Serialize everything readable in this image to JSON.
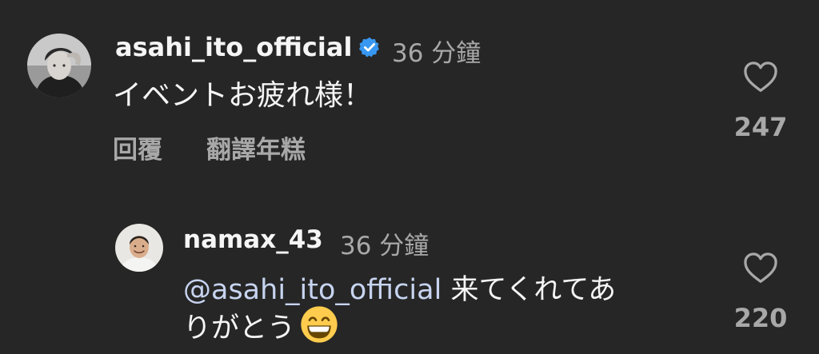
{
  "comments": [
    {
      "username": "asahi_ito_official",
      "verified": true,
      "time": "36 分鐘",
      "text": "イベントお疲れ様！",
      "actions": {
        "reply": "回覆",
        "translate": "翻譯年糕"
      },
      "likes": "247",
      "icons": {
        "avatar": "profile-photo",
        "badge": "verified-badge-icon",
        "like": "heart-outline-icon"
      }
    },
    {
      "username": "namax_43",
      "time": "36 分鐘",
      "mention": "@asahi_ito_official",
      "text_line1": "来てくれてあ",
      "text_line2": "りがとう",
      "emoji": "grinning-face-with-smiling-eyes",
      "likes": "220",
      "icons": {
        "avatar": "profile-photo",
        "like": "heart-outline-icon"
      }
    }
  ],
  "colors": {
    "background": "#262626",
    "primary_text": "#f5f5f5",
    "secondary_text": "#a8a8a8",
    "mention": "#c7d4f0",
    "verified_badge": "#3897f0"
  }
}
